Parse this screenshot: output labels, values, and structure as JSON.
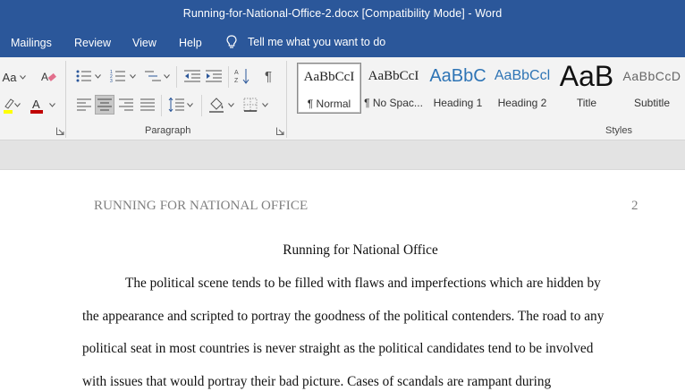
{
  "window": {
    "title": "Running-for-National-Office-2.docx [Compatibility Mode]  -  Word"
  },
  "tabs": [
    {
      "label": "Mailings"
    },
    {
      "label": "Review"
    },
    {
      "label": "View"
    },
    {
      "label": "Help"
    }
  ],
  "tell_me": {
    "placeholder": "Tell me what you want to do"
  },
  "ribbon": {
    "font_case_label": "Aa",
    "paragraph_group_label": "Paragraph",
    "styles_group_label": "Styles",
    "styles": [
      {
        "sample": "AaBbCcI",
        "name": "¶ Normal"
      },
      {
        "sample": "AaBbCcI",
        "name": "¶ No Spac..."
      },
      {
        "sample": "AaBbC",
        "name": "Heading 1"
      },
      {
        "sample": "AaBbCcl",
        "name": "Heading 2"
      },
      {
        "sample": "AaB",
        "name": "Title"
      },
      {
        "sample": "AaBbCcD",
        "name": "Subtitle"
      }
    ],
    "colors": {
      "font_color": "#c00000",
      "highlight": "#ffff00",
      "heading_blue": "#2e74b5"
    }
  },
  "document": {
    "running_head": "RUNNING FOR NATIONAL OFFICE",
    "page_number": "2",
    "title": "Running for National Office",
    "lines": [
      "The political scene tends to be filled with flaws and imperfections which are hidden by",
      "the appearance and scripted to portray the goodness of the political contenders. The road to any",
      "political seat in most countries is never straight as the political candidates tend to be involved",
      "with issues that would portray their bad picture. Cases of scandals are rampant during"
    ]
  }
}
